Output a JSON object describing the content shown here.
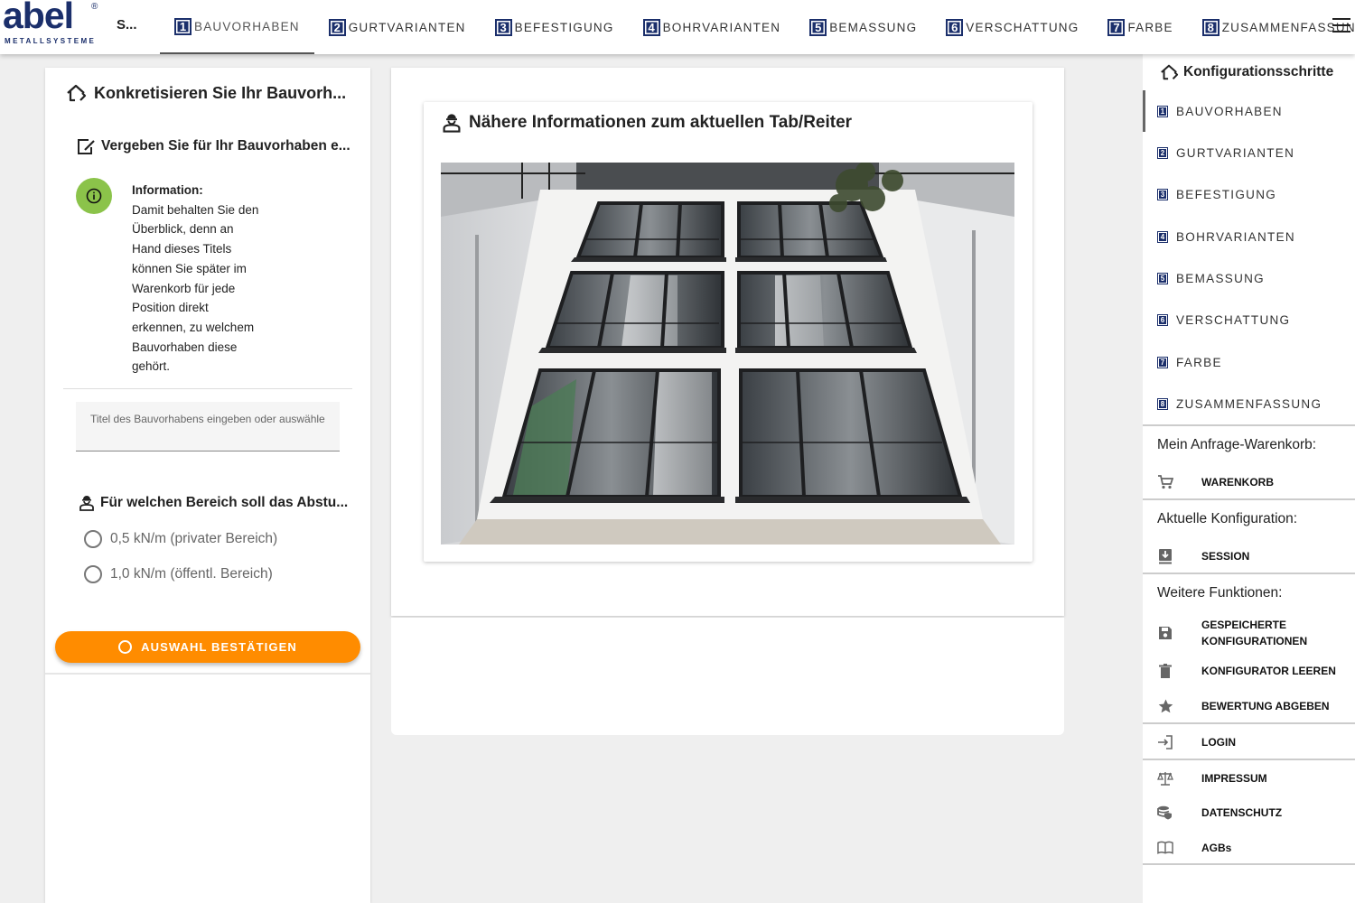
{
  "header": {
    "logo_text": "abel",
    "logo_sub": "METALLSYSTEME",
    "logo_reg": "®",
    "short_label": "S...",
    "tabs": [
      {
        "num": "1",
        "label": "BAUVORHABEN",
        "active": true
      },
      {
        "num": "2",
        "label": "GURTVARIANTEN"
      },
      {
        "num": "3",
        "label": "BEFESTIGUNG"
      },
      {
        "num": "4",
        "label": "BOHRVARIANTEN"
      },
      {
        "num": "5",
        "label": "BEMASSUNG"
      },
      {
        "num": "6",
        "label": "VERSCHATTUNG"
      },
      {
        "num": "7",
        "label": "FARBE"
      },
      {
        "num": "8",
        "label": "ZUSAMMENFASSUNG"
      }
    ]
  },
  "left": {
    "title": "Konkretisieren Sie Ihr Bauvorh...",
    "subtitle": "Vergeben Sie für Ihr Bauvorhaben e...",
    "info_heading": "Information:",
    "info_lines": [
      "Damit behalten Sie den",
      "Überblick, denn an",
      "Hand dieses Titels",
      "können Sie später im",
      "Warenkorb für jede",
      "Position direkt",
      "erkennen, zu welchem",
      "Bauvorhaben diese",
      "gehört."
    ],
    "input_placeholder": "Titel des Bauvorhabens eingeben oder auswählen",
    "question": "Für welchen Bereich soll das Abstu...",
    "options": [
      "0,5 kN/m (privater Bereich)",
      "1,0 kN/m (öffentl. Bereich)"
    ],
    "confirm_label": "AUSWAHL BESTÄTIGEN"
  },
  "center": {
    "card_title": "Nähere Informationen zum aktuellen Tab/Reiter"
  },
  "sidebar": {
    "title": "Konfigurationsschritte",
    "steps": [
      {
        "num": "1",
        "label": "BAUVORHABEN",
        "active": true
      },
      {
        "num": "2",
        "label": "GURTVARIANTEN"
      },
      {
        "num": "3",
        "label": "BEFESTIGUNG"
      },
      {
        "num": "4",
        "label": "BOHRVARIANTEN"
      },
      {
        "num": "5",
        "label": "BEMASSUNG"
      },
      {
        "num": "6",
        "label": "VERSCHATTUNG"
      },
      {
        "num": "7",
        "label": "FARBE"
      },
      {
        "num": "8",
        "label": "ZUSAMMENFASSUNG"
      }
    ],
    "cart_title": "Mein Anfrage-Warenkorb:",
    "cart_label": "WARENKORB",
    "config_title": "Aktuelle Konfiguration:",
    "session_label": "SESSION",
    "more_title": "Weitere Funktionen:",
    "saved_line1": "GESPEICHERTE",
    "saved_line2": "KONFIGURATIONEN",
    "clear_label": "KONFIGURATOR LEEREN",
    "rate_label": "BEWERTUNG ABGEBEN",
    "login_label": "LOGIN",
    "imprint_label": "IMPRESSUM",
    "privacy_label": "DATENSCHUTZ",
    "terms_label": "AGBs"
  },
  "colors": {
    "brand": "#1b2f6b",
    "accent": "#ff8c00",
    "info": "#8bc34a"
  },
  "icons": {
    "menu": "hamburger-icon",
    "home": "home-outline-icon",
    "edit": "edit-note-icon",
    "info": "info-icon",
    "person": "construction-worker-icon",
    "cart": "cart-icon",
    "session": "session-download-icon",
    "save": "save-icon",
    "delete": "trash-icon",
    "star": "star-icon",
    "login": "login-icon",
    "scale": "scale-icon",
    "privacy": "database-shield-icon",
    "book": "book-icon"
  }
}
